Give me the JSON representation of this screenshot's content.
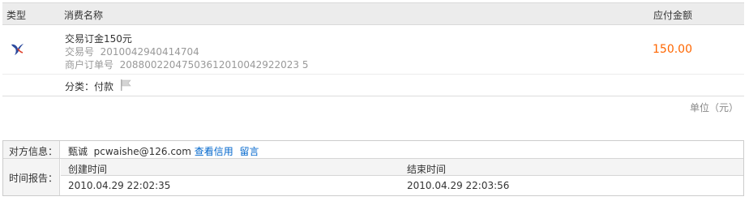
{
  "order_table": {
    "headers": {
      "type": "类型",
      "name": "消费名称",
      "amount": "应付金额"
    },
    "item": {
      "type_icon": "bird-logo-icon",
      "title": "交易订金150元",
      "trade_no_label": "交易号",
      "trade_no": "2010042940414704",
      "merchant_order_label": "商户订单号",
      "merchant_order_no": "20880022047503612010042922023 5",
      "amount": "150.00"
    },
    "category": {
      "label": "分类：付款",
      "icon": "flag-icon"
    },
    "unit_note": "单位（元）"
  },
  "info_table": {
    "counterparty": {
      "label": "对方信息：",
      "name": "甄诚",
      "email": "pcwaishe@126.com",
      "credit_link": "查看信用",
      "message_link": "留言"
    },
    "time_report": {
      "label": "时间报告：",
      "created_header": "创建时间",
      "ended_header": "结束时间",
      "created_value": "2010.04.29 22:02:35",
      "ended_value": "2010.04.29 22:03:56"
    }
  },
  "colors": {
    "amount": "#ff6600",
    "link": "#0066cc",
    "header_bg": "#ececec"
  }
}
